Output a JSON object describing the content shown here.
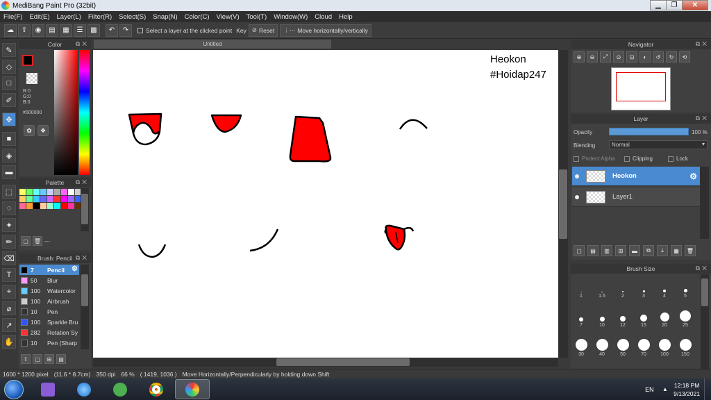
{
  "window": {
    "title": "MediBang Paint Pro (32bit)"
  },
  "menu": [
    "File(F)",
    "Edit(E)",
    "Layer(L)",
    "Filter(R)",
    "Select(S)",
    "Snap(N)",
    "Color(C)",
    "View(V)",
    "Tool(T)",
    "Window(W)",
    "Cloud",
    "Help"
  ],
  "toolbar": {
    "select_clicked_label": "Select a layer at the clicked point",
    "key_label": "Key",
    "reset_label": "Reset",
    "move_label": "Move horizontally/vertically"
  },
  "color_panel": {
    "title": "Color",
    "r": "R:0",
    "g": "G:0",
    "b": "B:0",
    "hex": "#000000",
    "fg_color": "#000000"
  },
  "palette_panel": {
    "title": "Palette",
    "colors": [
      "#ffff66",
      "#66ff66",
      "#66ffff",
      "#66ccff",
      "#ccccff",
      "#aaaaaa",
      "#ff66ff",
      "#ffffff",
      "#cccccc",
      "#999999",
      "#ffcc66",
      "#66ff99",
      "#33ccff",
      "#6666ff",
      "#cc66ff",
      "#ff3333",
      "#ff00ff",
      "#9966ff",
      "#3366ff",
      "#33ff66",
      "#ff6699",
      "#ff9933",
      "#000000",
      "#ffcc99",
      "#99ffcc",
      "#00ffff",
      "#ff0000",
      "#ff3399",
      "#663300",
      "#ffffff"
    ],
    "extra_label": "---"
  },
  "brush_panel": {
    "title": "Brush: Pencil",
    "items": [
      {
        "size": "7",
        "name": "Pencil",
        "color": "#000000"
      },
      {
        "size": "50",
        "name": "Blur",
        "color": "#ff99ff"
      },
      {
        "size": "100",
        "name": "Watercolor",
        "color": "#66ccff"
      },
      {
        "size": "100",
        "name": "Airbrush",
        "color": "#cccccc"
      },
      {
        "size": "10",
        "name": "Pen",
        "color": "#333333"
      },
      {
        "size": "100",
        "name": "Sparkle Bru",
        "color": "#3355ff"
      },
      {
        "size": "282",
        "name": "Rotation Sy",
        "color": "#ff3333"
      },
      {
        "size": "10",
        "name": "Pen (Sharp",
        "color": "#333333"
      }
    ]
  },
  "canvas": {
    "tab_title": "Untitled",
    "caption_line1": "Heokon",
    "caption_line2": "#Hoidap247"
  },
  "navigator": {
    "title": "Navigator"
  },
  "layer_panel": {
    "title": "Layer",
    "opacity_label": "Opacity",
    "opacity_value": "100 %",
    "opacity_fraction": 1.0,
    "blending_label": "Blending",
    "blending_value": "Normal",
    "protect_alpha_label": "Protect Alpha",
    "clipping_label": "Clipping",
    "lock_label": "Lock",
    "layers": [
      {
        "name": "Heokon",
        "selected": true
      },
      {
        "name": "Layer1",
        "selected": false
      }
    ]
  },
  "brush_size_panel": {
    "title": "Brush Size",
    "sizes": [
      "1",
      "1.5",
      "2",
      "3",
      "4",
      "5",
      "7",
      "10",
      "12",
      "15",
      "20",
      "25",
      "30",
      "40",
      "50",
      "70",
      "100",
      "150"
    ]
  },
  "status": {
    "dimensions": "1600 * 1200 pixel",
    "physical": "(11.6 * 8.7cm)",
    "dpi": "350 dpi",
    "zoom": "66 %",
    "cursor": "( 1419, 1036 )",
    "hint": "Move Horizontally/Perpendicularly by holding down Shift"
  },
  "taskbar": {
    "language": "EN",
    "time": "12:18 PM",
    "date": "9/13/2021"
  }
}
